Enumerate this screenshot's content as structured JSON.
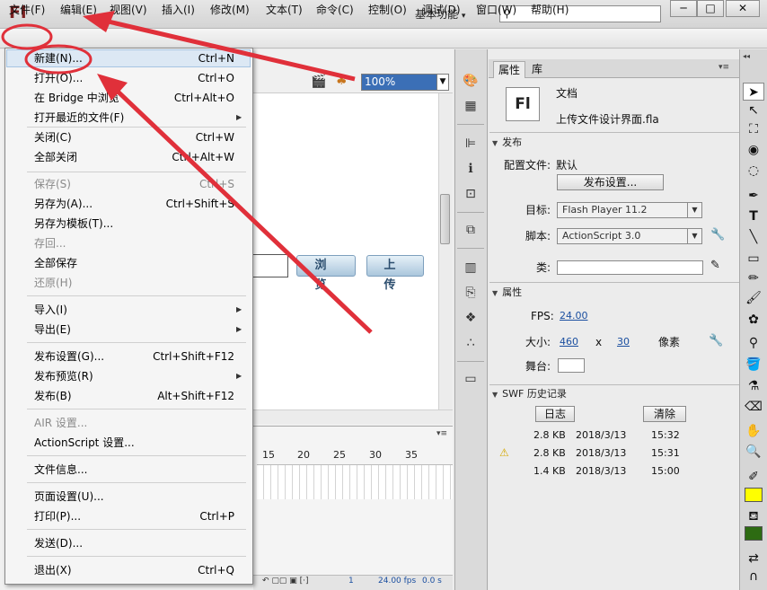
{
  "app": {
    "logo": "Fl",
    "workspace": "基本功能",
    "workspace_arrow": "▾"
  },
  "window": {
    "minimize": "─",
    "maximize": "□",
    "close": "✕"
  },
  "menubar": [
    "文件(F)",
    "编辑(E)",
    "视图(V)",
    "插入(I)",
    "修改(M)",
    "文本(T)",
    "命令(C)",
    "控制(O)",
    "调试(D)",
    "窗口(W)",
    "帮助(H)"
  ],
  "doc_toolbar": {
    "zoom": "100%"
  },
  "stage": {
    "browse_label": "浏 览",
    "upload_label": "上 传"
  },
  "timeline": {
    "frame_numbers": [
      "15",
      "20",
      "25",
      "30",
      "35"
    ],
    "current_frame": "1",
    "fps": "24.00 fps",
    "time": "0.0 s"
  },
  "file_menu": {
    "items": [
      {
        "label": "新建(N)...",
        "shortcut": "Ctrl+N",
        "disabled": false
      },
      {
        "label": "打开(O)...",
        "shortcut": "Ctrl+O",
        "disabled": false
      },
      {
        "label": "在 Bridge 中浏览",
        "shortcut": "Ctrl+Alt+O",
        "disabled": false
      },
      {
        "label": "打开最近的文件(F)",
        "shortcut": "",
        "disabled": false,
        "submenu": true
      },
      {
        "label": "关闭(C)",
        "shortcut": "Ctrl+W",
        "disabled": false
      },
      {
        "label": "全部关闭",
        "shortcut": "Ctrl+Alt+W",
        "disabled": false
      },
      {
        "label": "保存(S)",
        "shortcut": "Ctrl+S",
        "disabled": true
      },
      {
        "label": "另存为(A)...",
        "shortcut": "Ctrl+Shift+S",
        "disabled": false
      },
      {
        "label": "另存为模板(T)...",
        "shortcut": "",
        "disabled": false
      },
      {
        "label": "存回...",
        "shortcut": "",
        "disabled": true
      },
      {
        "label": "全部保存",
        "shortcut": "",
        "disabled": false
      },
      {
        "label": "还原(H)",
        "shortcut": "",
        "disabled": true
      },
      {
        "label": "导入(I)",
        "shortcut": "",
        "disabled": false,
        "submenu": true
      },
      {
        "label": "导出(E)",
        "shortcut": "",
        "disabled": false,
        "submenu": true
      },
      {
        "label": "发布设置(G)...",
        "shortcut": "Ctrl+Shift+F12",
        "disabled": false
      },
      {
        "label": "发布预览(R)",
        "shortcut": "",
        "disabled": false,
        "submenu": true
      },
      {
        "label": "发布(B)",
        "shortcut": "Alt+Shift+F12",
        "disabled": false
      },
      {
        "label": "AIR 设置...",
        "shortcut": "",
        "disabled": true
      },
      {
        "label": "ActionScript 设置...",
        "shortcut": "",
        "disabled": false
      },
      {
        "label": "文件信息...",
        "shortcut": "",
        "disabled": false
      },
      {
        "label": "页面设置(U)...",
        "shortcut": "",
        "disabled": false
      },
      {
        "label": "打印(P)...",
        "shortcut": "Ctrl+P",
        "disabled": false
      },
      {
        "label": "发送(D)...",
        "shortcut": "",
        "disabled": false
      },
      {
        "label": "退出(X)",
        "shortcut": "Ctrl+Q",
        "disabled": false
      }
    ]
  },
  "panel": {
    "tabs": [
      "属性",
      "库"
    ],
    "doc_label": "文档",
    "doc_icon": "Fl",
    "filename": "上传文件设计界面.fla",
    "publish": {
      "header": "发布",
      "profile_label": "配置文件:",
      "profile_value": "默认",
      "settings_button": "发布设置...",
      "target_label": "目标:",
      "target_value": "Flash Player 11.2",
      "script_label": "脚本:",
      "script_value": "ActionScript 3.0",
      "class_label": "类:"
    },
    "properties": {
      "header": "属性",
      "fps_label": "FPS:",
      "fps_value": "24.00",
      "size_label": "大小:",
      "width": "460",
      "x_sep": "x",
      "height": "30",
      "unit": "像素",
      "stage_label": "舞台:"
    },
    "swf_history": {
      "header": "SWF 历史记录",
      "log_button": "日志",
      "clear_button": "清除",
      "rows": [
        {
          "size": "2.8 KB",
          "date": "2018/3/13",
          "time": "15:32",
          "warning": false
        },
        {
          "size": "2.8 KB",
          "date": "2018/3/13",
          "time": "15:31",
          "warning": true
        },
        {
          "size": "1.4 KB",
          "date": "2018/3/13",
          "time": "15:00",
          "warning": false
        }
      ]
    }
  },
  "colors": {
    "accent_red": "#e0303a",
    "fill_color": "#ffff00",
    "stroke_color": "#2d6b12",
    "highlight": "#dce8f4"
  }
}
